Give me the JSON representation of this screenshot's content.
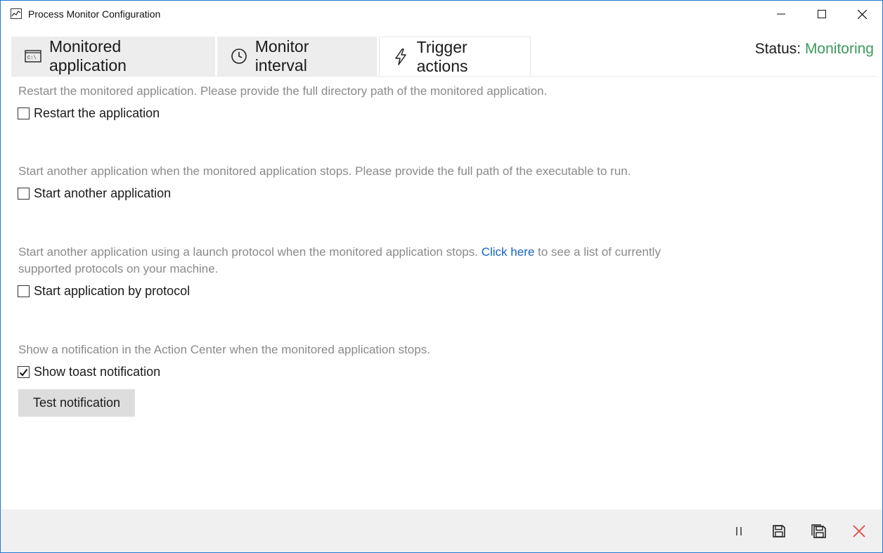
{
  "window": {
    "title": "Process Monitor Configuration",
    "icons": [
      "app-icon",
      "minimize-icon",
      "maximize-icon",
      "close-icon"
    ]
  },
  "tabs": [
    {
      "label": "Monitored application",
      "icon": "console-icon"
    },
    {
      "label": "Monitor interval",
      "icon": "clock-icon"
    },
    {
      "label": "Trigger actions",
      "icon": "lightning-icon",
      "selected": true
    }
  ],
  "status": {
    "label": "Status:",
    "value": "Monitoring",
    "value_color": "#3c9a5f"
  },
  "sections": {
    "restart": {
      "description": "Restart the monitored application. Please provide the full directory path of the monitored application.",
      "checkbox_label": "Restart the application",
      "checked": false
    },
    "start_another": {
      "description": "Start another application when the monitored application stops. Please provide the full path of the executable to run.",
      "checkbox_label": "Start another application",
      "checked": false
    },
    "protocol": {
      "description_before": "Start another application using a launch protocol when the monitored application stops. ",
      "link_text": "Click here",
      "description_after": " to see a list of currently supported protocols on your machine.",
      "checkbox_label": "Start application by protocol",
      "checked": false
    },
    "toast": {
      "description": "Show a notification in the Action Center when the monitored application stops.",
      "checkbox_label": "Show toast notification",
      "checked": true,
      "button_label": "Test notification"
    }
  },
  "bottom_bar": {
    "buttons": [
      "pause-icon",
      "save-icon",
      "save-all-icon",
      "cancel-icon"
    ],
    "cancel_color": "#e04848"
  }
}
